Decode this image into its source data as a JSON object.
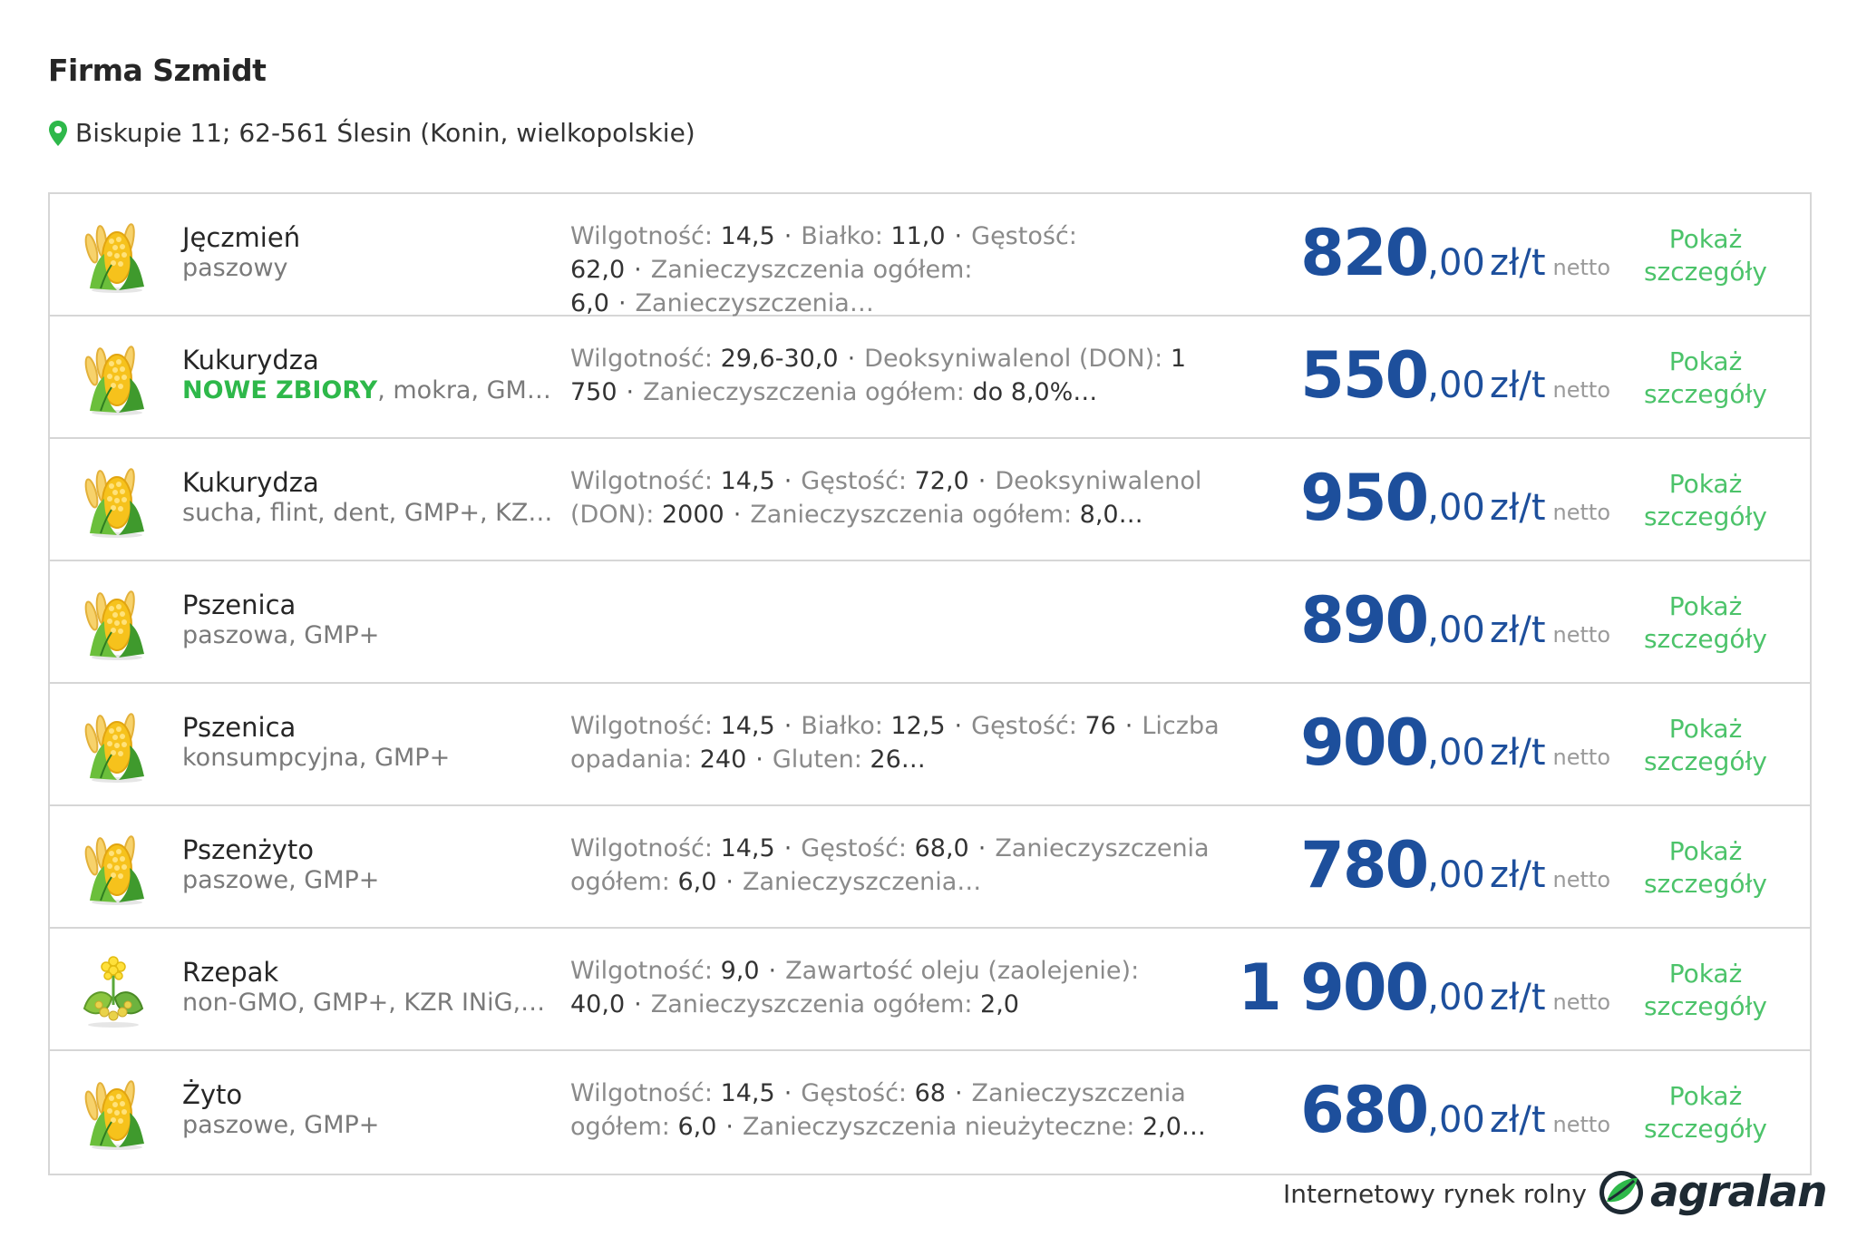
{
  "company": {
    "name": "Firma Szmidt",
    "address": "Biskupie 11; 62-561 Ślesin (Konin, wielkopolskie)",
    "pin_icon": "location-pin-icon",
    "pin_color": "#2eb84a"
  },
  "common": {
    "details_line1": "Pokaż",
    "details_line2": "szczegóły",
    "unit": "zł/t",
    "netto": "netto"
  },
  "colors": {
    "price": "#1d4f9c",
    "details_link": "#4cc36a",
    "new_badge": "#2eb84a"
  },
  "offers": [
    {
      "name": "Jęczmień",
      "icon": "corn-icon",
      "badge": "",
      "desc": "paszowy",
      "params": [
        {
          "label": "Wilgotność: ",
          "value": "14,5"
        },
        {
          "label": "Białko: ",
          "value": "11,0"
        },
        {
          "label": "Gęstość: ",
          "value": "62,0"
        },
        {
          "label": "Zanieczyszczenia ogółem: ",
          "value": "6,0"
        },
        {
          "label": "Zanieczyszczenia…",
          "value": ""
        }
      ],
      "price_main": "820",
      "price_dec": ",00"
    },
    {
      "name": "Kukurydza",
      "icon": "corn-icon",
      "badge": "NOWE ZBIORY",
      "desc": ", mokra, GMP+…",
      "params": [
        {
          "label": "Wilgotność: ",
          "value": "29,6-30,0"
        },
        {
          "label": "Deoksyniwalenol (DON): ",
          "value": "1 750"
        },
        {
          "label": "Zanieczyszczenia ogółem: ",
          "value": "do 8,0%…"
        }
      ],
      "price_main": "550",
      "price_dec": ",00"
    },
    {
      "name": "Kukurydza",
      "icon": "corn-icon",
      "badge": "",
      "desc": "sucha, flint, dent, GMP+, KZR…",
      "params": [
        {
          "label": "Wilgotność: ",
          "value": "14,5"
        },
        {
          "label": "Gęstość: ",
          "value": "72,0"
        },
        {
          "label": "Deoksyniwalenol (DON): ",
          "value": "2000"
        },
        {
          "label": "Zanieczyszczenia ogółem: ",
          "value": "8,0…"
        }
      ],
      "price_main": "950",
      "price_dec": ",00"
    },
    {
      "name": "Pszenica",
      "icon": "corn-icon",
      "badge": "",
      "desc": "paszowa, GMP+",
      "params": [],
      "price_main": "890",
      "price_dec": ",00"
    },
    {
      "name": "Pszenica",
      "icon": "corn-icon",
      "badge": "",
      "desc": "konsumpcyjna, GMP+",
      "params": [
        {
          "label": "Wilgotność: ",
          "value": "14,5"
        },
        {
          "label": "Białko: ",
          "value": "12,5"
        },
        {
          "label": "Gęstość: ",
          "value": "76"
        },
        {
          "label": "Liczba opadania: ",
          "value": "240"
        },
        {
          "label": "Gluten: ",
          "value": "26…"
        }
      ],
      "price_main": "900",
      "price_dec": ",00"
    },
    {
      "name": "Pszenżyto",
      "icon": "corn-icon",
      "badge": "",
      "desc": "paszowe, GMP+",
      "params": [
        {
          "label": "Wilgotność: ",
          "value": "14,5"
        },
        {
          "label": "Gęstość: ",
          "value": "68,0"
        },
        {
          "label": "Zanieczyszczenia ogółem: ",
          "value": "6,0"
        },
        {
          "label": "Zanieczyszczenia…",
          "value": ""
        }
      ],
      "price_main": "780",
      "price_dec": ",00"
    },
    {
      "name": "Rzepak",
      "icon": "rapeseed-icon",
      "badge": "",
      "desc": "non-GMO, GMP+, KZR INiG,…",
      "params": [
        {
          "label": "Wilgotność: ",
          "value": "9,0"
        },
        {
          "label": "Zawartość oleju (zaolejenie): ",
          "value": "40,0"
        },
        {
          "label": "Zanieczyszczenia ogółem: ",
          "value": "2,0"
        }
      ],
      "price_main": "1 900",
      "price_dec": ",00"
    },
    {
      "name": "Żyto",
      "icon": "corn-icon",
      "badge": "",
      "desc": "paszowe, GMP+",
      "params": [
        {
          "label": "Wilgotność: ",
          "value": "14,5"
        },
        {
          "label": "Gęstość: ",
          "value": "68"
        },
        {
          "label": "Zanieczyszczenia ogółem: ",
          "value": "6,0"
        },
        {
          "label": "Zanieczyszczenia nieużyteczne: ",
          "value": "2,0…"
        }
      ],
      "price_main": "680",
      "price_dec": ",00"
    }
  ],
  "footer": {
    "tagline": "Internetowy rynek rolny",
    "logo_text": "agralan",
    "logo_icon": "agralan-leaf-icon"
  }
}
